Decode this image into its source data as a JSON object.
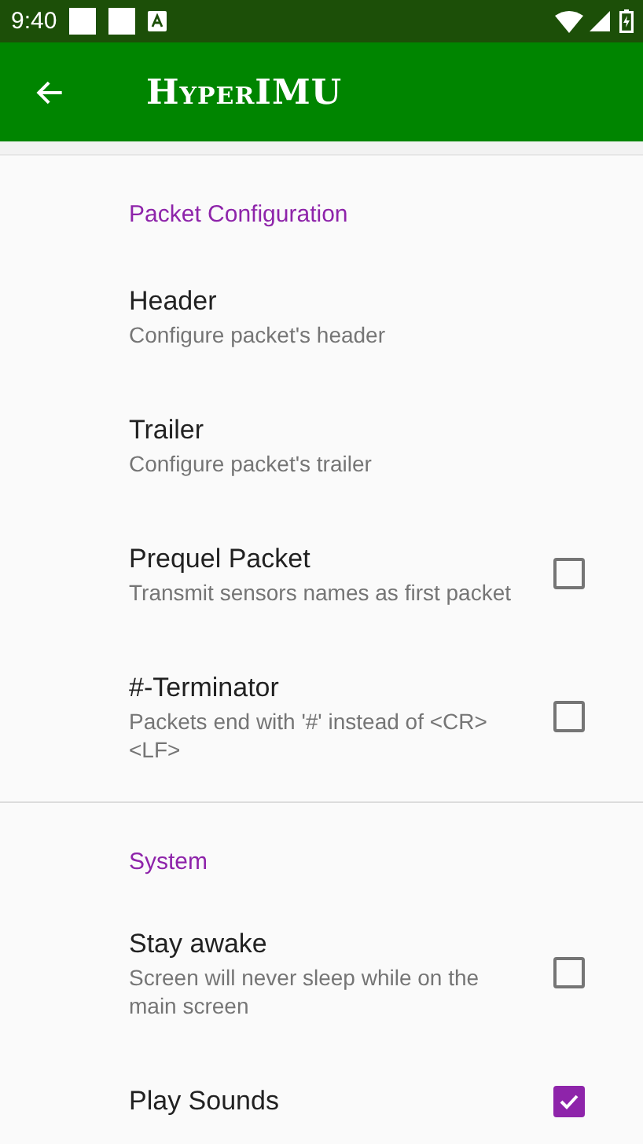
{
  "status_bar": {
    "time": "9:40"
  },
  "app_bar": {
    "title": "HyperIMU"
  },
  "sections": [
    {
      "title": "Packet Configuration",
      "items": [
        {
          "kind": "preference",
          "title": "Header",
          "summary": "Configure packet's header"
        },
        {
          "kind": "preference",
          "title": "Trailer",
          "summary": "Configure packet's trailer"
        },
        {
          "kind": "checkbox",
          "title": "Prequel Packet",
          "summary": "Transmit sensors names as first packet",
          "checked": false
        },
        {
          "kind": "checkbox",
          "title": "#-Terminator",
          "summary": "Packets end with '#' instead of <CR><LF>",
          "checked": false
        }
      ]
    },
    {
      "title": "System",
      "items": [
        {
          "kind": "checkbox",
          "title": "Stay awake",
          "summary": "Screen will never sleep while on the main screen",
          "checked": false
        },
        {
          "kind": "checkbox",
          "title": "Play Sounds",
          "checked": true
        }
      ]
    }
  ]
}
